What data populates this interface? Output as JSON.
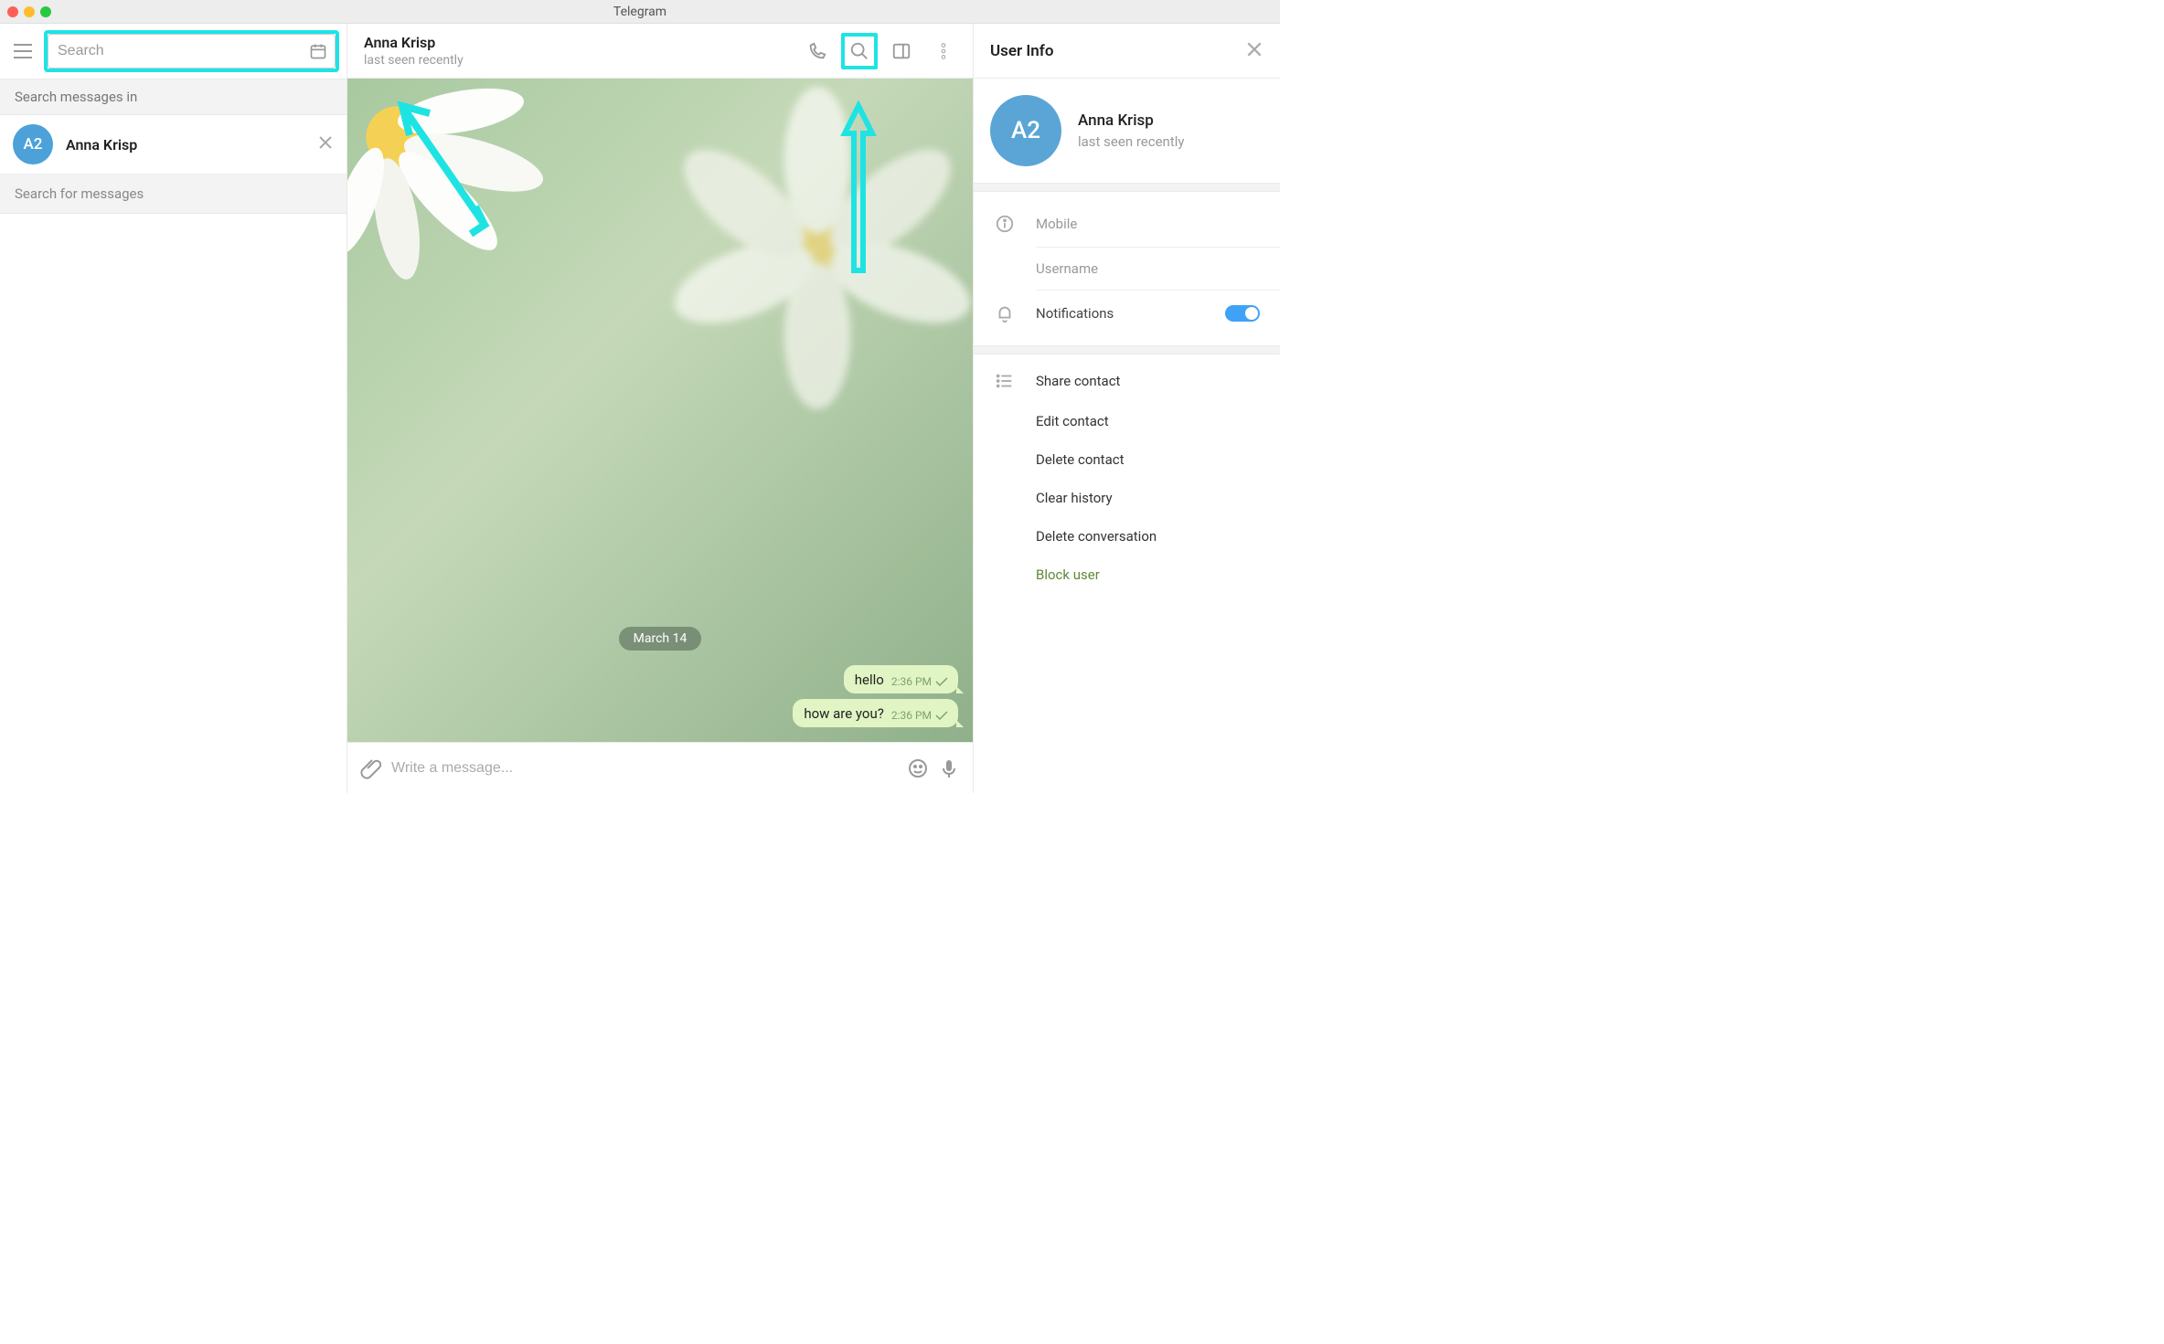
{
  "titlebar": {
    "title": "Telegram"
  },
  "sidebar": {
    "search_placeholder": "Search",
    "section_label": "Search messages in",
    "hint": "Search for messages",
    "chat": {
      "avatar_initials": "A2",
      "name": "Anna Krisp"
    }
  },
  "chat": {
    "header": {
      "name": "Anna Krisp",
      "status": "last seen recently"
    },
    "date_badge": "March 14",
    "messages": [
      {
        "text": "hello",
        "time": "2:36 PM"
      },
      {
        "text": "how are you?",
        "time": "2:36 PM"
      }
    ],
    "composer_placeholder": "Write a message..."
  },
  "info": {
    "title": "User Info",
    "avatar_initials": "A2",
    "name": "Anna Krisp",
    "status": "last seen recently",
    "mobile_label": "Mobile",
    "username_label": "Username",
    "notifications_label": "Notifications",
    "actions": {
      "share": "Share contact",
      "edit": "Edit contact",
      "delete_contact": "Delete contact",
      "clear_history": "Clear history",
      "delete_conversation": "Delete conversation",
      "block": "Block user"
    }
  }
}
